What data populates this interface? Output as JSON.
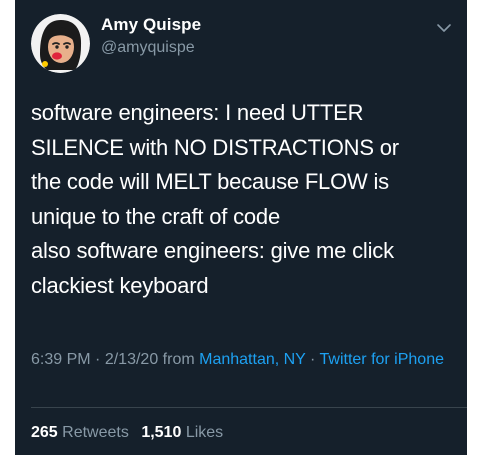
{
  "user": {
    "display_name": "Amy Quispe",
    "handle": "@amyquispe"
  },
  "icons": {
    "menu": "chevron-down-icon",
    "avatar": "avatar-illustration"
  },
  "tweet": {
    "text": "software engineers: I need UTTER\nSILENCE with NO DISTRACTIONS or\nthe code will MELT because FLOW is\nunique to the craft of code\nalso software engineers: give me click\nclackiest keyboard"
  },
  "meta": {
    "time": "6:39 PM",
    "date": "2/13/20",
    "from_label": "from",
    "location": "Manhattan, NY",
    "source": "Twitter for iPhone",
    "separator": "·"
  },
  "stats": {
    "retweets_count": "265",
    "retweets_label": "Retweets",
    "likes_count": "1,510",
    "likes_label": "Likes"
  },
  "colors": {
    "background": "#15202b",
    "text_primary": "#ffffff",
    "text_secondary": "#8899a6",
    "link": "#1da1f2",
    "divider": "#38444d"
  }
}
